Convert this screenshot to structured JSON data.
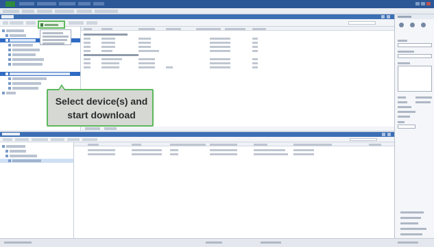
{
  "callout": {
    "line1": "Select device(s) and",
    "line2": "start download"
  },
  "colors": {
    "title_bar": "#2b5797",
    "pane_header": "#3c6eb4",
    "selection": "#2f6bc4",
    "callout_border": "#5cb85c",
    "callout_fill": "#d6d8d4"
  },
  "icons": [
    "logo-icon",
    "load-device-icon",
    "device-icon",
    "properties-icon",
    "window-close-icon"
  ]
}
